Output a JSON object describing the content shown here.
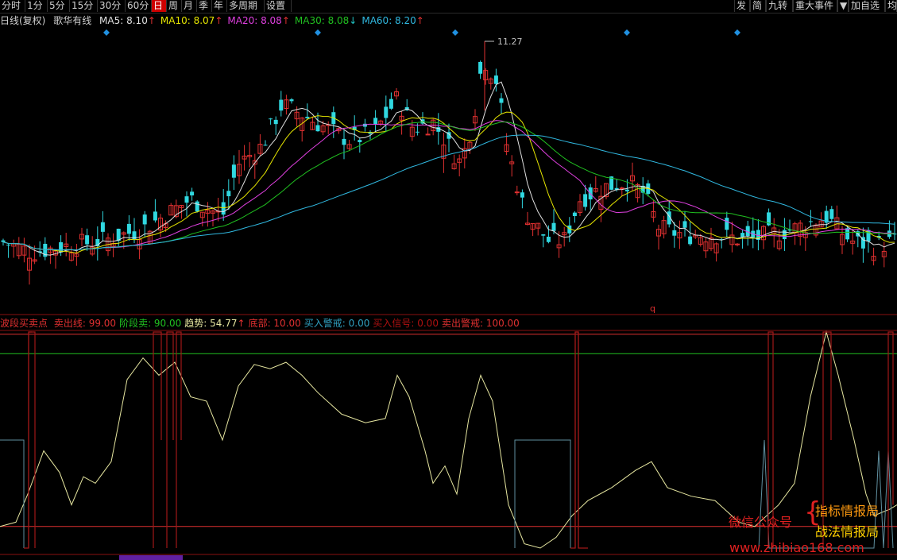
{
  "toolbar": {
    "left_buttons": [
      {
        "label": "分时",
        "active": false
      },
      {
        "label": "1分",
        "active": false
      },
      {
        "label": "5分",
        "active": false
      },
      {
        "label": "15分",
        "active": false
      },
      {
        "label": "30分",
        "active": false
      },
      {
        "label": "60分",
        "active": false
      },
      {
        "label": "日",
        "active": true
      },
      {
        "label": "周",
        "active": false
      },
      {
        "label": "月",
        "active": false
      },
      {
        "label": "季",
        "active": false
      },
      {
        "label": "年",
        "active": false
      },
      {
        "label": "多周期",
        "active": false
      },
      {
        "label": "设置",
        "active": false
      }
    ],
    "right_buttons": [
      {
        "label": "发"
      },
      {
        "label": "简"
      },
      {
        "label": "九转"
      },
      {
        "label": "重大事件"
      },
      {
        "label": "▼"
      },
      {
        "label": "加自选"
      },
      {
        "label": "均"
      }
    ]
  },
  "price_header": {
    "period": "日线(复权)",
    "stock": "歌华有线",
    "ma": [
      {
        "name": "MA5:",
        "value": "8.10",
        "arrow": "↑",
        "color": "#e0e0e0"
      },
      {
        "name": "MA10:",
        "value": "8.07",
        "arrow": "↑",
        "color": "#e6e600"
      },
      {
        "name": "MA20:",
        "value": "8.08",
        "arrow": "↑",
        "color": "#e040e0"
      },
      {
        "name": "MA30:",
        "value": "8.08",
        "arrow": "↓",
        "color": "#20c020"
      },
      {
        "name": "MA60:",
        "value": "8.20",
        "arrow": "↑",
        "color": "#30b8e0"
      }
    ],
    "high_label": "11.27",
    "marker_label": "q"
  },
  "indicator_header": {
    "title": "波段买卖点",
    "items": [
      {
        "name": "卖出线:",
        "value": "99.00",
        "color": "#e03030"
      },
      {
        "name": "阶段卖:",
        "value": "90.00",
        "color": "#20c020"
      },
      {
        "name": "趋势:",
        "value": "54.77",
        "arrow": "↑",
        "color": "#e6e6a0"
      },
      {
        "name": "底部:",
        "value": "10.00",
        "color": "#e03030"
      },
      {
        "name": "买入警戒:",
        "value": "0.00",
        "color": "#30a0c0"
      },
      {
        "name": "买入信号:",
        "value": "0.00",
        "color": "#b01010"
      },
      {
        "name": "卖出警戒:",
        "value": "100.00",
        "color": "#e03030"
      }
    ]
  },
  "watermark": {
    "left": "微信公众号",
    "line1": "指标情报局",
    "line2": "战法情报局",
    "url": "www.zhibiao168.com"
  }
}
